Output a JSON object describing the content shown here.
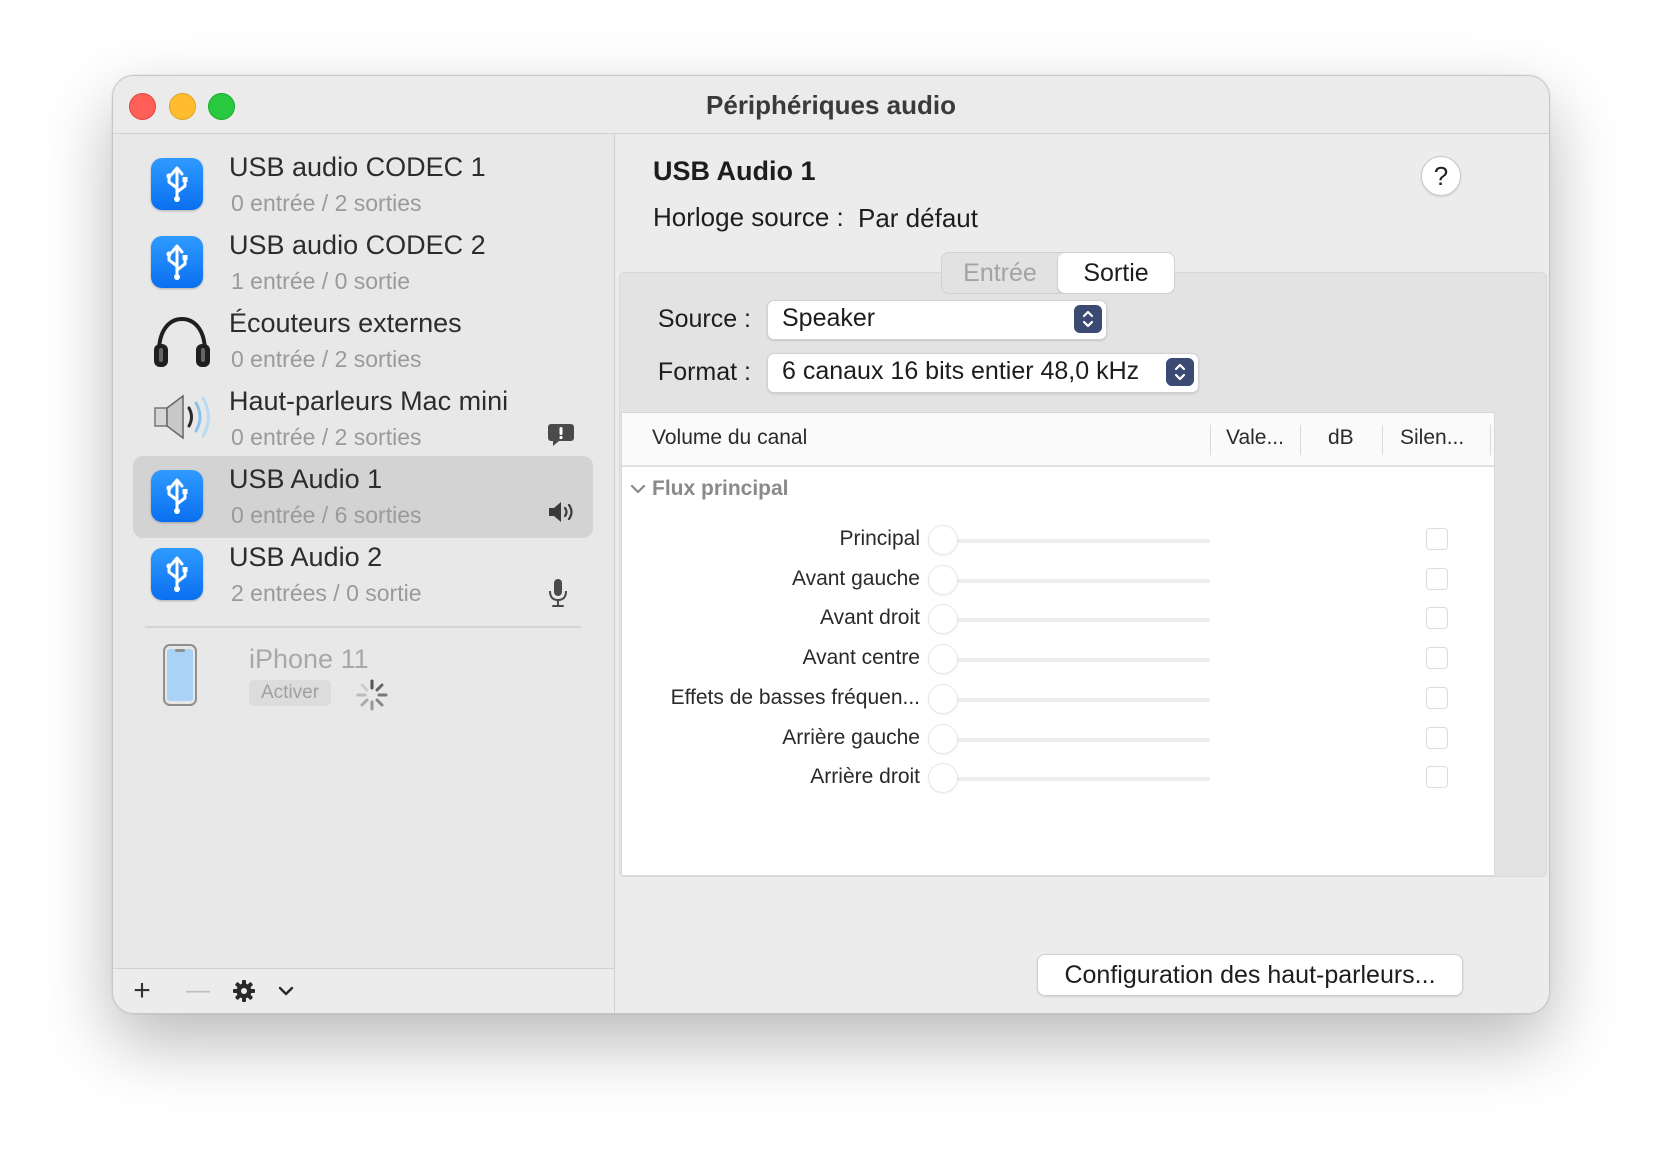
{
  "window": {
    "title": "Périphériques audio"
  },
  "sidebar": {
    "devices": [
      {
        "name": "USB audio CODEC 1",
        "sub": "0 entrée / 2 sorties",
        "icon": "usb-icon",
        "status": ""
      },
      {
        "name": "USB audio CODEC 2",
        "sub": "1 entrée / 0 sortie",
        "icon": "usb-icon",
        "status": ""
      },
      {
        "name": "Écouteurs externes",
        "sub": "0 entrée / 2 sorties",
        "icon": "headphones-icon",
        "status": ""
      },
      {
        "name": "Haut-parleurs Mac mini",
        "sub": "0 entrée / 2 sorties",
        "icon": "speaker-icon",
        "status": "alert-bubble-icon"
      },
      {
        "name": "USB Audio 1",
        "sub": "0 entrée / 6 sorties",
        "icon": "usb-icon",
        "status": "speaker-volume-icon",
        "selected": true
      },
      {
        "name": "USB Audio 2",
        "sub": "2 entrées / 0 sortie",
        "icon": "usb-icon",
        "status": "microphone-icon"
      }
    ],
    "iphone": {
      "name": "iPhone 11",
      "action": "Activer"
    },
    "bottom": {
      "add": "+",
      "remove": "—"
    }
  },
  "detail": {
    "device_title": "USB Audio 1",
    "clock_label": "Horloge source :",
    "clock_value": "Par défaut",
    "help": "?",
    "tabs": [
      {
        "label": "Entrée",
        "active": false
      },
      {
        "label": "Sortie",
        "active": true
      }
    ],
    "source_label": "Source :",
    "source_value": "Speaker",
    "format_label": "Format :",
    "format_value": "6 canaux 16 bits entier 48,0 kHz",
    "table": {
      "columns": [
        "Volume du canal",
        "Vale...",
        "dB",
        "Silen..."
      ],
      "group": "Flux principal",
      "channels": [
        {
          "label": "Principal",
          "value": 0,
          "muted": false
        },
        {
          "label": "Avant gauche",
          "value": 0,
          "muted": false
        },
        {
          "label": "Avant droit",
          "value": 0,
          "muted": false
        },
        {
          "label": "Avant centre",
          "value": 0,
          "muted": false
        },
        {
          "label": "Effets de basses fréquen...",
          "value": 0,
          "muted": false
        },
        {
          "label": "Arrière gauche",
          "value": 0,
          "muted": false
        },
        {
          "label": "Arrière droit",
          "value": 0,
          "muted": false
        }
      ]
    },
    "config_button": "Configuration des haut-parleurs..."
  },
  "colors": {
    "accent": "#0a6ff0",
    "popup_arrow": "#3b4a73",
    "selection": "#d3d3d3"
  }
}
